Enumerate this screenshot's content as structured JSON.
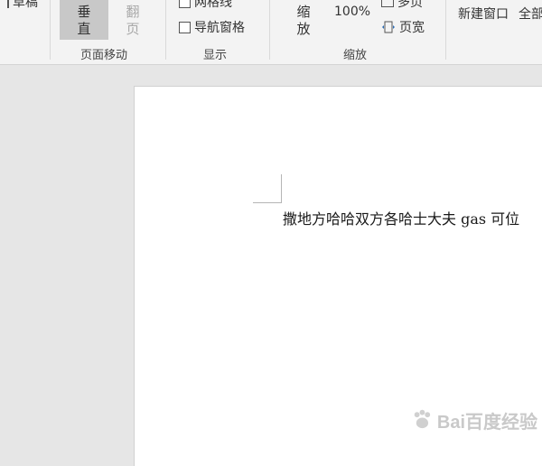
{
  "ribbon": {
    "views_group": {
      "draft_label": "草稿"
    },
    "page_movement": {
      "vertical_label": "垂直",
      "flip_label": "翻页",
      "group_label": "页面移动"
    },
    "show": {
      "gridlines_label": "网格线",
      "gridlines_checked": false,
      "nav_pane_label": "导航窗格",
      "nav_pane_checked": false,
      "group_label": "显示"
    },
    "zoom": {
      "zoom_label": "缩放",
      "percent_label": "100%",
      "multi_page_label": "多页",
      "page_width_label": "页宽",
      "group_label": "缩放"
    },
    "window": {
      "new_window_label": "新建窗口",
      "all_label": "全部"
    }
  },
  "document": {
    "body_text": "撒地方哈哈双方各哈士大夫 gas 可位"
  },
  "watermark": {
    "text": "Bai百度经验"
  },
  "colors": {
    "ribbon_bg": "#f3f3f3",
    "canvas_bg": "#e6e6e6",
    "selected_button_bg": "#c8c8c8",
    "disabled_text": "#a8a8a8",
    "page_bg": "#ffffff"
  }
}
